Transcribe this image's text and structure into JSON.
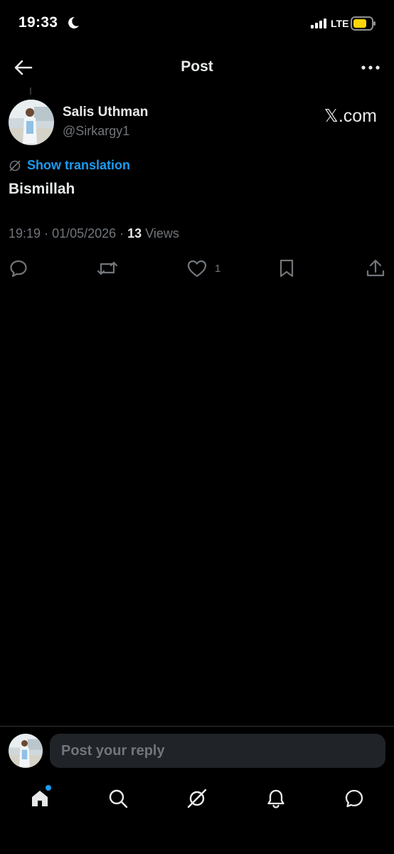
{
  "status_bar": {
    "time": "19:33",
    "network": "LTE"
  },
  "nav": {
    "title": "Post"
  },
  "post": {
    "author_name": "Salis Uthman",
    "author_handle": "@Sirkargy1",
    "source": "𝕏.com",
    "translate_label": "Show translation",
    "text": "Bismillah",
    "time": "19:19",
    "date": "01/05/2026",
    "views_count": "13",
    "views_label": "Views",
    "likes": "1"
  },
  "reply": {
    "placeholder": "Post your reply"
  },
  "colors": {
    "accent": "#1d9bf0",
    "muted": "#71767b",
    "text": "#e7e9ea",
    "background": "#000000",
    "battery": "#ffd60a"
  },
  "icons": [
    "back-arrow-icon",
    "more-icon",
    "translate-icon",
    "reply-icon",
    "retweet-icon",
    "like-icon",
    "bookmark-icon",
    "share-icon",
    "home-icon",
    "search-icon",
    "grok-icon",
    "notifications-icon",
    "messages-icon"
  ]
}
